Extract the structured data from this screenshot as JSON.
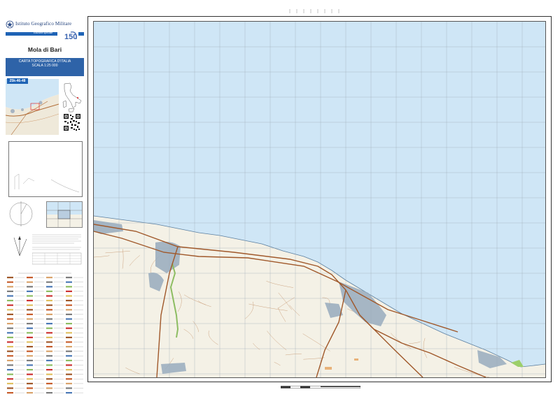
{
  "header": {
    "institute": "Istituto Geografico Militare",
    "edition": "Edizione speciale",
    "anniversary_logo": "150"
  },
  "sheet": {
    "title": "Mola di Bari",
    "series_title": "CARTA TOPOGRAFICA D'ITALIA",
    "scale": "SCALA 1:25 000",
    "sheet_code": "25k-46-48"
  },
  "map": {
    "sea_color": "#cfe6f6",
    "land_color": "#f4f1e6",
    "road_color": "#a0582a",
    "urban_color": "#8fa5b8",
    "grid_color": "#8a8a8a"
  },
  "icons": {
    "emblem": "italian-republic-emblem-icon",
    "north_arrow": "north-arrow-icon",
    "qr": "qr-code-icon"
  }
}
